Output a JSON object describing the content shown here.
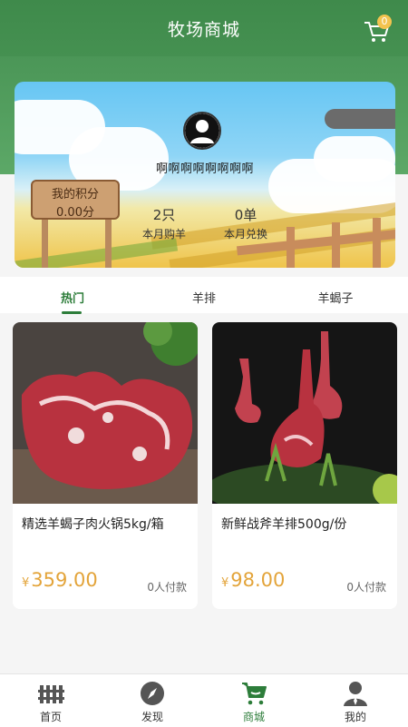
{
  "header": {
    "title": "牧场商城",
    "cart_badge": "0",
    "cart_icon": "cart-icon"
  },
  "profile": {
    "nickname": "啊啊啊啊啊啊啊啊",
    "points_label": "我的积分",
    "points_value": "0.00分",
    "stats": [
      {
        "value": "2只",
        "label": "本月购羊"
      },
      {
        "value": "0单",
        "label": "本月兑换"
      }
    ]
  },
  "tabs": [
    {
      "label": "热门",
      "active": true
    },
    {
      "label": "羊排",
      "active": false
    },
    {
      "label": "羊蝎子",
      "active": false
    }
  ],
  "products": [
    {
      "name": "精选羊蝎子肉火锅5kg/箱",
      "currency": "¥",
      "price": "359.00",
      "paid": "0人付款"
    },
    {
      "name": "新鲜战斧羊排500g/份",
      "currency": "¥",
      "price": "98.00",
      "paid": "0人付款"
    }
  ],
  "nav": [
    {
      "label": "首页",
      "icon": "home-fence-icon",
      "active": false
    },
    {
      "label": "发现",
      "icon": "compass-icon",
      "active": false
    },
    {
      "label": "商城",
      "icon": "shopping-cart-icon",
      "active": true
    },
    {
      "label": "我的",
      "icon": "user-icon",
      "active": false
    }
  ],
  "colors": {
    "primary": "#2d7d3a",
    "header_green": "#4a9656",
    "price": "#e3a43a",
    "badge": "#f3c34f"
  }
}
